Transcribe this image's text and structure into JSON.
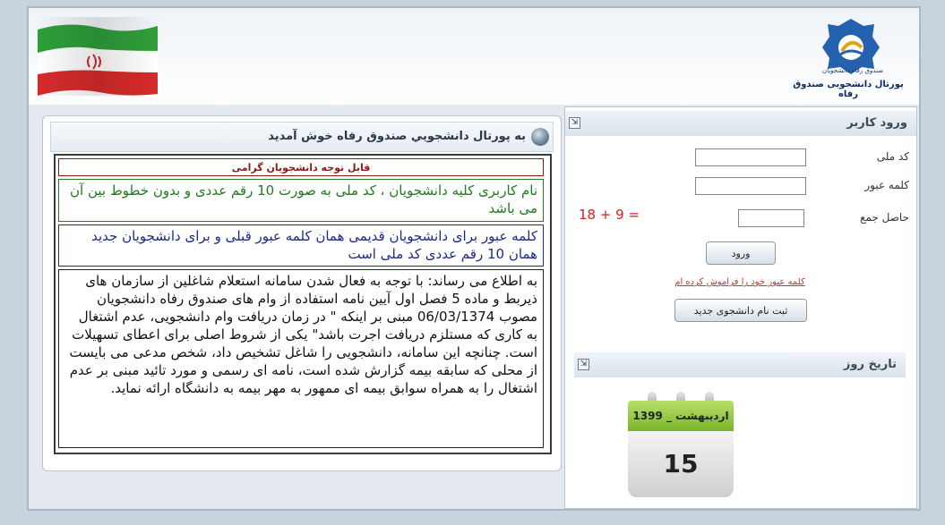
{
  "header": {
    "portal_title": "پورتال دانشجویی صندوق رفاه",
    "logo_caption": "صندوق رفاه دانشجویان"
  },
  "main": {
    "welcome": "به پورتال دانشجويي صندوق رفاه خوش آمديد",
    "notice_title": "قابل توجه دانشجویان گرامی",
    "notice_username": "نام کاربری کلیه دانشجویان ، کد ملی به صورت 10 رقم عددی و بدون خطوط بین آن می باشد",
    "notice_password": "کلمه عبور برای دانشجویان قدیمی همان کلمه عبور قبلی و برای دانشجویان جدید همان 10 رقم عددی کد ملی است",
    "notice_body": "به اطلاع می رساند: با توجه به فعال شدن سامانه استعلام شاغلین از سازمان های ذیربط و ماده 5 فصل اول آیین نامه استفاده از وام های صندوق رفاه دانشجویان مصوب 06/03/1374 مبنی بر اینکه \" در زمان دریافت وام دانشجویی، عدم اشتغال به کاری که مستلزم دریافت اجرت باشد\" یکی از شروط اصلی برای اعطای تسهیلات است. چنانچه این سامانه، دانشجویی را شاغل تشخیص داد، شخص مدعی می بایست از محلی که سابقه بیمه گزارش شده است، نامه ای رسمی و مورد تائید مبنی بر عدم اشتغال را به همراه سوابق بیمه ای ممهور به مهر بیمه به دانشگاه ارائه نماید."
  },
  "login": {
    "title": "ورود کاربر",
    "national_code_label": "کد ملی",
    "password_label": "کلمه عبور",
    "captcha_label": "حاصل جمع",
    "captcha_expr": "18 + 9 =",
    "login_button": "ورود",
    "forgot_link": "کلمه عبور خود را فراموش کرده ام",
    "register_button": "ثبت نام دانشجوی جدید"
  },
  "today": {
    "title": "تاریخ روز",
    "month_year": "اردیبهشت _ 1399",
    "day": "15"
  },
  "colors": {
    "accent_green": "#79b52a",
    "notice_red": "#8b1a1a",
    "notice_green": "#1f7a1f",
    "notice_blue": "#1a2a8a"
  },
  "icons": [
    "iran-flag-icon",
    "sfrah-logo-icon",
    "orb-bullet-icon",
    "collapse-icon",
    "calendar-icon"
  ]
}
